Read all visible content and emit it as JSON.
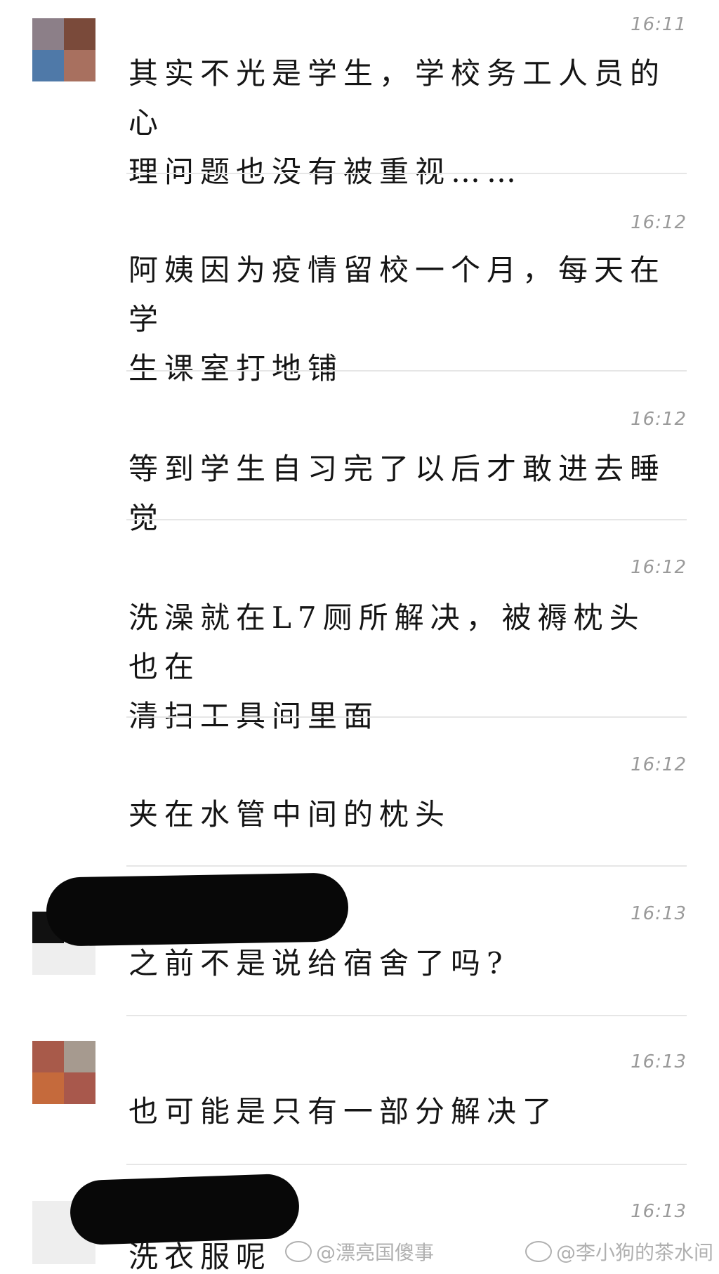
{
  "messages": [
    {
      "time": "16:11",
      "lines": [
        "其实不光是学生，学校务工人员的心",
        "理问题也没有被重视……"
      ],
      "avatar_colors": [
        "#8c7f88",
        "#7a4a3a",
        "#4f79a8",
        "#a8705f"
      ]
    },
    {
      "time": "16:12",
      "lines": [
        "阿姨因为疫情留校一个月，每天在学",
        "生课室打地铺"
      ]
    },
    {
      "time": "16:12",
      "lines": [
        "等到学生自习完了以后才敢进去睡觉"
      ]
    },
    {
      "time": "16:12",
      "lines": [
        "洗澡就在L7厕所解决，被褥枕头也在",
        "清扫工具间里面"
      ]
    },
    {
      "time": "16:12",
      "lines": [
        "夹在水管中间的枕头"
      ]
    },
    {
      "time": "16:13",
      "lines": [
        "之前不是说给宿舍了吗?"
      ]
    },
    {
      "time": "16:13",
      "lines": [
        "也可能是只有一部分解决了"
      ],
      "avatar_colors": [
        "#a85a4a",
        "#a69a8f",
        "#c56a3c",
        "#a8584c"
      ]
    },
    {
      "time": "16:13",
      "lines": [
        "洗衣服呢"
      ]
    }
  ],
  "watermarks": [
    "@漂亮国傻事",
    "@李小狗的茶水间"
  ],
  "colors": {
    "divider": "#e6e6e6",
    "timestamp": "#9a9a9a",
    "redaction": "#080808"
  }
}
